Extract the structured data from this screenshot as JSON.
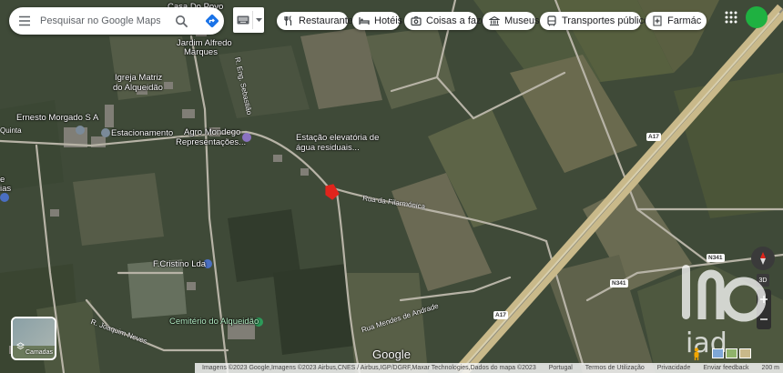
{
  "search": {
    "placeholder": "Pesquisar no Google Maps"
  },
  "categories": [
    {
      "label": "Restaurantes",
      "icon": "restaurant-icon"
    },
    {
      "label": "Hotéis",
      "icon": "hotel-icon"
    },
    {
      "label": "Coisas a fazer",
      "icon": "camera-icon"
    },
    {
      "label": "Museus",
      "icon": "museum-icon"
    },
    {
      "label": "Transportes públicos",
      "icon": "bus-icon"
    },
    {
      "label": "Farmác",
      "icon": "pharmacy-icon"
    }
  ],
  "places": {
    "casa_do_povo": "Casa Do Povo",
    "jardim_1": "Jardim Alfredo",
    "jardim_2": "Marques",
    "igreja_1": "Igreja Matriz",
    "igreja_2": "do Alqueidão",
    "ernesto": "Ernesto Morgado S A",
    "estacionamento": "Estacionamento",
    "agro_1": "Agro Mondego",
    "agro_2": "Representações...",
    "estacao_1": "Estação elevatória de",
    "estacao_2": "água residuais...",
    "fcristino": "F.Cristino Lda",
    "cemiterio": "Cemitério do Alqueidão",
    "left_partial": "ias",
    "left_partial2": "e",
    "quinta": "Quinta"
  },
  "roads": {
    "filarmonica": "Rua da Filarmónica",
    "mendes": "Rua Mendes de Andrade",
    "neves": "R. Joaquim Neves",
    "engenheiro": "R. Eng. Sebastião"
  },
  "shields": {
    "a17a": "A17",
    "a17b": "A17",
    "n341a": "N341",
    "n341b": "N341"
  },
  "layers": {
    "label": "Camadas"
  },
  "watermark": "Google",
  "footer": {
    "attribution": "Imagens ©2023 Google,Imagens ©2023 Airbus,CNES / Airbus,IGP/DGRF,Maxar Technologies,Dados do mapa ©2023",
    "country": "Portugal",
    "terms": "Termos de Utilização",
    "privacy": "Privacidade",
    "feedback": "Enviar feedback",
    "scale": "200 m"
  },
  "colors": {
    "search_arrow": "#1a73e8",
    "marker": "#e0241c",
    "poi": "#8a72c0",
    "avatar": "#1fb141",
    "highway": "#c9b98a"
  }
}
